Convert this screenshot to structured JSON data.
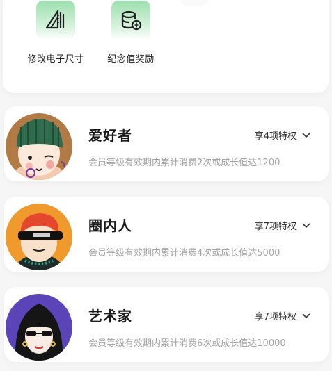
{
  "benefits": [
    {
      "label": "修改电子尺寸",
      "icon": "ruler-triangle-icon"
    },
    {
      "label": "纪念值奖励",
      "icon": "coins-stack-icon"
    }
  ],
  "levels": [
    {
      "title": "爱好者",
      "perks": "享4项特权",
      "desc": "会员等级有效期内累计消费2次或成长值达1200",
      "avatar": "green-beanie-girl-avatar"
    },
    {
      "title": "圈内人",
      "perks": "享7项特权",
      "desc": "会员等级有效期内累计消费4次或成长值达5000",
      "avatar": "sunglasses-redhead-avatar"
    },
    {
      "title": "艺术家",
      "perks": "享7项特权",
      "desc": "会员等级有效期内累计消费6次或成长值达10000",
      "avatar": "black-hair-purple-bg-avatar"
    }
  ],
  "colors": {
    "accent_green": "#7ed69a",
    "text_dark": "#1a1a1a",
    "text_muted": "#a3a3a3"
  }
}
